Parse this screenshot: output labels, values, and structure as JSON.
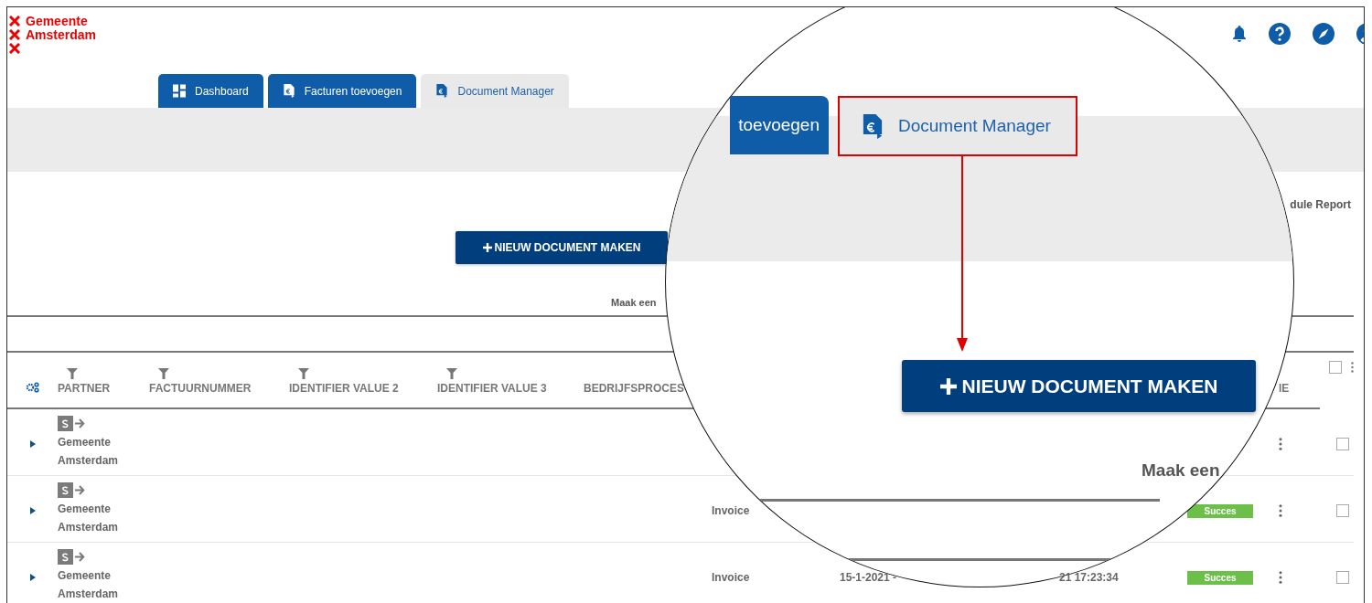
{
  "logo": {
    "lines": [
      "Gemeente",
      "Amsterdam"
    ]
  },
  "tabs": [
    {
      "label": "Dashboard",
      "selected": false
    },
    {
      "label": "Facturen toevoegen",
      "selected": false
    },
    {
      "label": "Document Manager",
      "selected": true
    }
  ],
  "report_link": "dule Report",
  "new_button": "NIEUW DOCUMENT MAKEN",
  "hint": "Maak een",
  "table": {
    "columns": [
      {
        "label": "PARTNER",
        "filter": true
      },
      {
        "label": "FACTUURNUMMER",
        "filter": true
      },
      {
        "label": "IDENTIFIER VALUE 2",
        "filter": true
      },
      {
        "label": "IDENTIFIER VALUE 3",
        "filter": true
      },
      {
        "label": "BEDRIJFSPROCES",
        "filter": false
      },
      {
        "label": "IE",
        "filter": false
      }
    ],
    "select_all": false,
    "rows": [
      {
        "expanded": false,
        "partner": "Gemeente Amsterdam",
        "type": "",
        "date": "",
        "date2": "",
        "status": "",
        "checked": false
      },
      {
        "expanded": false,
        "partner": "Gemeente Amsterdam",
        "type": "Invoice",
        "date": "",
        "date2": "",
        "status": "Succes",
        "checked": false
      },
      {
        "expanded": false,
        "partner": "Gemeente Amsterdam",
        "type": "Invoice",
        "date": "15-1-2021 -",
        "date2": "21 17:23:34",
        "status": "Succes",
        "checked": false
      }
    ]
  },
  "magnifier": {
    "tab_partial": "toevoegen",
    "tab_selected": "Document Manager",
    "button": "NIEUW DOCUMENT MAKEN",
    "hint": "Maak een"
  }
}
